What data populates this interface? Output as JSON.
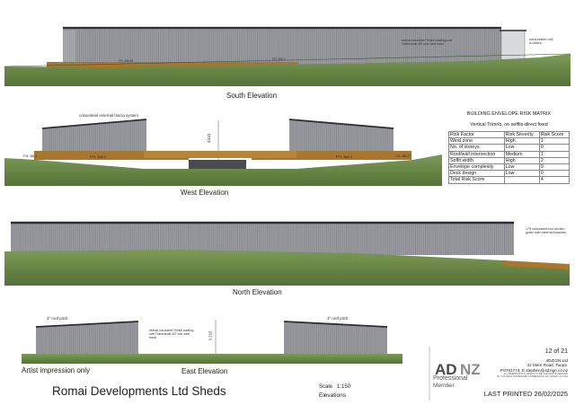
{
  "elevations": {
    "south": {
      "title": "South Elevation",
      "note_cladding": "vertical coloursteel Trimlib cladding over Thermakraft 407 over steel frame",
      "note_doors": "coloursteel roll-a-doors",
      "ffl_left": "FFL 386.65",
      "ffl_right": "FFL 386.0"
    },
    "west": {
      "title": "West Elevation",
      "note_fascia": "coloursteel external fascia system",
      "dimension": "4410",
      "ffl_left": "FFL 386.9",
      "ffl_right": "FFL 386.9",
      "level_left": "FGL 385.3",
      "level_right": "FGL 385.27"
    },
    "north": {
      "title": "North Elevation",
      "note_gutter": "175 coloursteel box section gutter with external brackets"
    },
    "east": {
      "title": "East Elevation",
      "pitch_left": "3° roof pitch",
      "pitch_right": "3° roof pitch",
      "note_cladding": "vertical coloursteel Trimlib cladding over Thermakraft 407 over steel frame",
      "dimension": "3 210"
    }
  },
  "risk_matrix": {
    "title": "BUILDING ENVELOPE RISK MATRIX",
    "subtitle": "Vertical Trimrib, no soffits-direct fixed",
    "headers": [
      "Risk Factor",
      "Risk Severity",
      "Risk Score"
    ],
    "rows": [
      [
        "Wind zone",
        "High",
        "1"
      ],
      [
        "No. of storeys",
        "Low",
        "0"
      ],
      [
        "Roof/wall intersection",
        "Medium",
        "1"
      ],
      [
        "Soffit width",
        "High",
        "2"
      ],
      [
        "Envelope complexity",
        "Low",
        "0"
      ],
      [
        "Deck design",
        "Low",
        "0"
      ],
      [
        "Total Risk Score",
        "",
        "4"
      ]
    ]
  },
  "footer": {
    "artist_note": "Artist impression only",
    "project_title": "Romai Developments Ltd Sheds",
    "scale": "Scale   1:150",
    "sheet_name": "Elevations"
  },
  "title_block": {
    "page": "12 of 21",
    "company": "4DZIGN Ltd",
    "address": "42 Mere Road, Taupo.",
    "contact": "P.0781774, E.stephen@4dzign.co.nz",
    "fine_print_1": "ALL DIMENSIONS & LEVELS TO BE CHECKED & VERIFIED",
    "fine_print_2": "BY CONTRACTOR BEFORE COMMENCING ANY WORK ON SITE",
    "logo_text": "ADNZ",
    "logo_sub1": "Professional",
    "logo_sub2": "Member",
    "printed": "LAST PRINTED 26/02/2025"
  },
  "colors": {
    "wall": "#95979c",
    "wall_dark": "#5f6166",
    "roof_line": "#2e2f33",
    "deck": "#a8762c",
    "grass": "#6f8f4c",
    "grass_dark": "#526e38"
  }
}
